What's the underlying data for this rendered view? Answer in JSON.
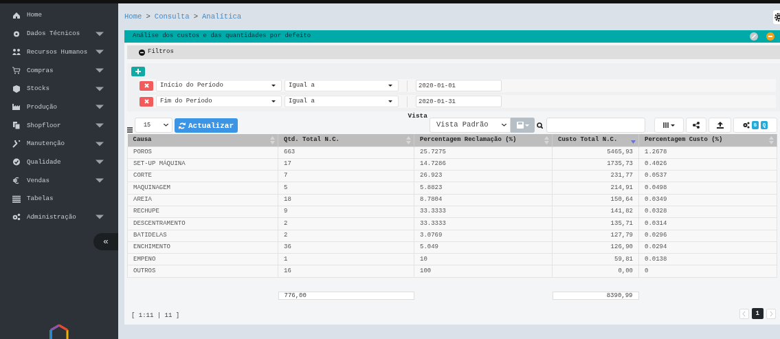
{
  "sidebar": {
    "items": [
      {
        "label": "Home",
        "has_submenu": false
      },
      {
        "label": "Dados Técnicos",
        "has_submenu": true
      },
      {
        "label": "Recursos Humanos",
        "has_submenu": true
      },
      {
        "label": "Compras",
        "has_submenu": true
      },
      {
        "label": "Stocks",
        "has_submenu": true
      },
      {
        "label": "Produção",
        "has_submenu": true
      },
      {
        "label": "Shopfloor",
        "has_submenu": true
      },
      {
        "label": "Manutenção",
        "has_submenu": true
      },
      {
        "label": "Qualidade",
        "has_submenu": true
      },
      {
        "label": "Vendas",
        "has_submenu": true
      },
      {
        "label": "Tabelas",
        "has_submenu": false
      },
      {
        "label": "Administração",
        "has_submenu": true
      }
    ],
    "collapse_button": "«"
  },
  "breadcrumb": [
    "Home",
    "Consulta",
    "Analítica"
  ],
  "breadcrumb_separator": ">",
  "panel": {
    "title": "Análise dos custos e das quantidades por defeito",
    "filters": {
      "title": "Filtros",
      "expanded": true,
      "rows": [
        {
          "field": "Início do Período",
          "operator": "Igual a",
          "value": "2020-01-01"
        },
        {
          "field": "Fim do Período",
          "operator": "Igual a",
          "value": "2020-01-31"
        }
      ]
    },
    "page_size": "15",
    "refresh_button": "Actualizar",
    "view_label": "Vista",
    "view_select": "Vista Padrão",
    "badges": [
      "G",
      "Q"
    ],
    "table": {
      "columns": [
        {
          "label": "Causa",
          "sorted": false
        },
        {
          "label": "Qtd. Total N.C.",
          "sorted": false,
          "total": "776,00"
        },
        {
          "label": "Percentagem Reclamação (%)",
          "sorted": false
        },
        {
          "label": "Custo Total N.C.",
          "sorted": true,
          "total": "8390,99"
        },
        {
          "label": "Percentagem Custo (%)",
          "sorted": false
        }
      ],
      "rows": [
        [
          "POROS",
          "663",
          "25.7275",
          "5465,93",
          "1.2678"
        ],
        [
          "SET-UP MÁQUINA",
          "17",
          "14.7286",
          "1735,73",
          "0.4026"
        ],
        [
          "CORTE",
          "7",
          "26.923",
          "231,77",
          "0.0537"
        ],
        [
          "MAQUINAGEM",
          "5",
          "5.8823",
          "214,91",
          "0.0498"
        ],
        [
          "AREIA",
          "18",
          "8.7804",
          "150,64",
          "0.0349"
        ],
        [
          "RECHUPE",
          "9",
          "33.3333",
          "141,82",
          "0.0328"
        ],
        [
          "DESCENTRAMENTO",
          "2",
          "33.3333",
          "135,71",
          "0.0314"
        ],
        [
          "BATIDELAS",
          "2",
          "3.0769",
          "127,79",
          "0.0296"
        ],
        [
          "ENCHIMENTO",
          "36",
          "5.049",
          "126,90",
          "0.0294"
        ],
        [
          "EMPENO",
          "1",
          "10",
          "59,81",
          "0.0138"
        ],
        [
          "OUTROS",
          "16",
          "100",
          "0,00",
          "0"
        ]
      ]
    },
    "record_info": "[ 1:11 | 11 ]",
    "pages": [
      {
        "label": "1",
        "selected": true
      }
    ]
  }
}
